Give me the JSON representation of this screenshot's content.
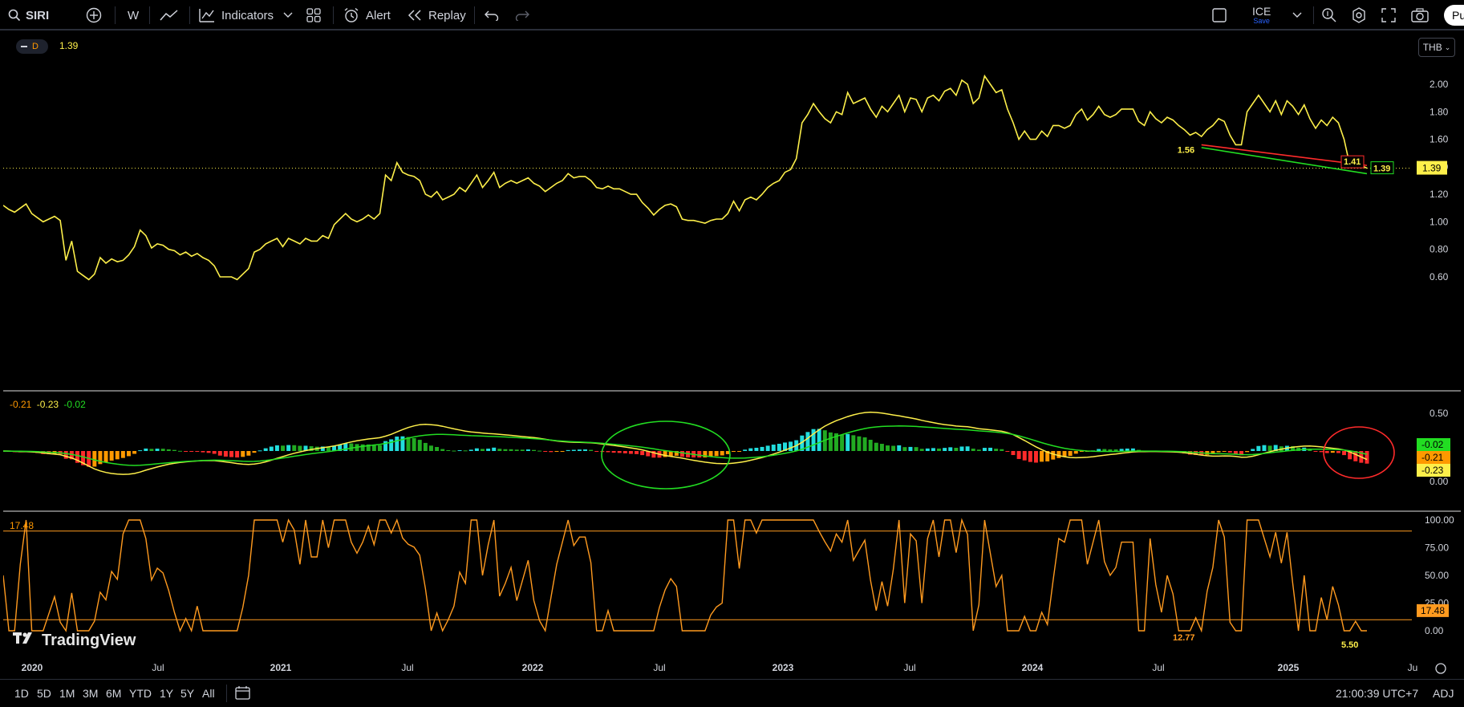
{
  "toolbar": {
    "symbol": "SIRI",
    "interval": "W",
    "indicators_label": "Indicators",
    "alert_label": "Alert",
    "replay_label": "Replay",
    "layout_name": "ICE",
    "layout_status": "Save",
    "publish_label": "Pu"
  },
  "main_pane": {
    "interval_badge": "D",
    "last_value": "1.39",
    "currency": "THB",
    "price_axis": [
      "2.00",
      "1.80",
      "1.60",
      "1.40",
      "1.20",
      "1.00",
      "0.80",
      "0.60"
    ],
    "last_price_label": "1.39",
    "box_price_label": "1.39",
    "annotations": {
      "start_label": "1.56",
      "end_label": "1.41"
    },
    "colors": {
      "price_line": "#fdef4a",
      "upper_trend": "#ff2b2b",
      "lower_trend": "#22dd22",
      "last_price_tag": "#fdef4a"
    }
  },
  "osc_pane": {
    "legend": [
      "-0.21",
      "-0.23",
      "-0.02"
    ],
    "axis": [
      "0.50",
      "0.00"
    ],
    "tags": [
      "-0.02",
      "-0.21",
      "-0.23"
    ],
    "colors": {
      "signal": "#fdef4a",
      "slow": "#22dd22",
      "hist_pos": "#22dddd",
      "hist_neg": "#ff2b2b",
      "hist_neg_light": "#ff9900"
    }
  },
  "stoch_pane": {
    "legend": "17.48",
    "axis": [
      "100.00",
      "75.00",
      "50.00",
      "25.00",
      "0.00"
    ],
    "last_tag": "17.48",
    "low_labels": [
      "12.77",
      "5.50"
    ],
    "upper_level": 90,
    "lower_level": 10,
    "colors": {
      "line": "#ff9a1f"
    }
  },
  "time_axis": [
    "2020",
    "Jul",
    "2021",
    "Jul",
    "2022",
    "Jul",
    "2023",
    "Jul",
    "2024",
    "Jul",
    "2025",
    "Ju"
  ],
  "watermark": "TradingView",
  "bottom": {
    "ranges": [
      "1D",
      "5D",
      "1M",
      "3M",
      "6M",
      "YTD",
      "1Y",
      "5Y",
      "All"
    ],
    "clock": "21:00:39 UTC+7",
    "adj": "ADJ"
  },
  "chart_data": {
    "type": "line",
    "x_start": "2020-01",
    "x_step": "week",
    "series": [
      {
        "values": [
          1.12,
          1.09,
          1.07,
          1.1,
          1.13,
          1.06,
          1.03,
          1.0,
          1.02,
          1.04,
          1.01,
          0.72,
          0.86,
          0.64,
          0.61,
          0.58,
          0.62,
          0.74,
          0.7,
          0.73,
          0.71,
          0.72,
          0.76,
          0.82,
          0.94,
          0.9,
          0.81,
          0.84,
          0.83,
          0.8,
          0.79,
          0.76,
          0.78,
          0.75,
          0.77,
          0.74,
          0.72,
          0.68,
          0.6,
          0.6,
          0.6,
          0.58,
          0.62,
          0.66,
          0.78,
          0.8,
          0.84,
          0.86,
          0.88,
          0.82,
          0.88,
          0.86,
          0.84,
          0.88,
          0.86,
          0.86,
          0.9,
          0.88,
          0.98,
          1.02,
          1.06,
          1.02,
          1.0,
          1.02,
          1.05,
          1.02,
          1.06,
          1.34,
          1.3,
          1.43,
          1.36,
          1.34,
          1.33,
          1.3,
          1.2,
          1.18,
          1.22,
          1.16,
          1.18,
          1.2,
          1.25,
          1.22,
          1.28,
          1.34,
          1.25,
          1.3,
          1.36,
          1.25,
          1.28,
          1.3,
          1.28,
          1.3,
          1.32,
          1.28,
          1.26,
          1.22,
          1.25,
          1.28,
          1.3,
          1.35,
          1.32,
          1.33,
          1.33,
          1.3,
          1.25,
          1.24,
          1.26,
          1.24,
          1.24,
          1.22,
          1.2,
          1.2,
          1.14,
          1.1,
          1.05,
          1.09,
          1.12,
          1.13,
          1.11,
          1.02,
          1.01,
          1.01,
          1.0,
          0.99,
          1.01,
          1.02,
          1.02,
          1.06,
          1.15,
          1.08,
          1.16,
          1.18,
          1.16,
          1.2,
          1.25,
          1.28,
          1.3,
          1.36,
          1.38,
          1.46,
          1.72,
          1.78,
          1.86,
          1.8,
          1.75,
          1.72,
          1.8,
          1.78,
          1.94,
          1.86,
          1.88,
          1.9,
          1.82,
          1.76,
          1.84,
          1.8,
          1.86,
          1.92,
          1.8,
          1.9,
          1.89,
          1.8,
          1.9,
          1.92,
          1.88,
          1.95,
          1.97,
          1.92,
          2.03,
          2.0,
          1.86,
          1.9,
          2.06,
          2.0,
          1.94,
          1.96,
          1.82,
          1.72,
          1.6,
          1.66,
          1.6,
          1.6,
          1.66,
          1.62,
          1.7,
          1.7,
          1.68,
          1.7,
          1.78,
          1.82,
          1.74,
          1.78,
          1.84,
          1.78,
          1.76,
          1.78,
          1.82,
          1.82,
          1.82,
          1.73,
          1.7,
          1.8,
          1.75,
          1.72,
          1.76,
          1.74,
          1.7,
          1.67,
          1.63,
          1.65,
          1.62,
          1.67,
          1.7,
          1.75,
          1.73,
          1.63,
          1.56,
          1.56,
          1.8,
          1.86,
          1.92,
          1.86,
          1.8,
          1.88,
          1.78,
          1.88,
          1.84,
          1.78,
          1.85,
          1.75,
          1.68,
          1.74,
          1.7,
          1.76,
          1.72,
          1.6,
          1.41,
          1.44,
          1.41,
          1.39
        ]
      },
      {
        "name": "trend-upper",
        "values": [
          1.56,
          1.41
        ]
      },
      {
        "name": "trend-lower",
        "values": [
          1.54,
          1.35
        ]
      }
    ],
    "ylim": [
      0.45,
      2.1
    ],
    "xlabel": "",
    "ylabel": ""
  }
}
